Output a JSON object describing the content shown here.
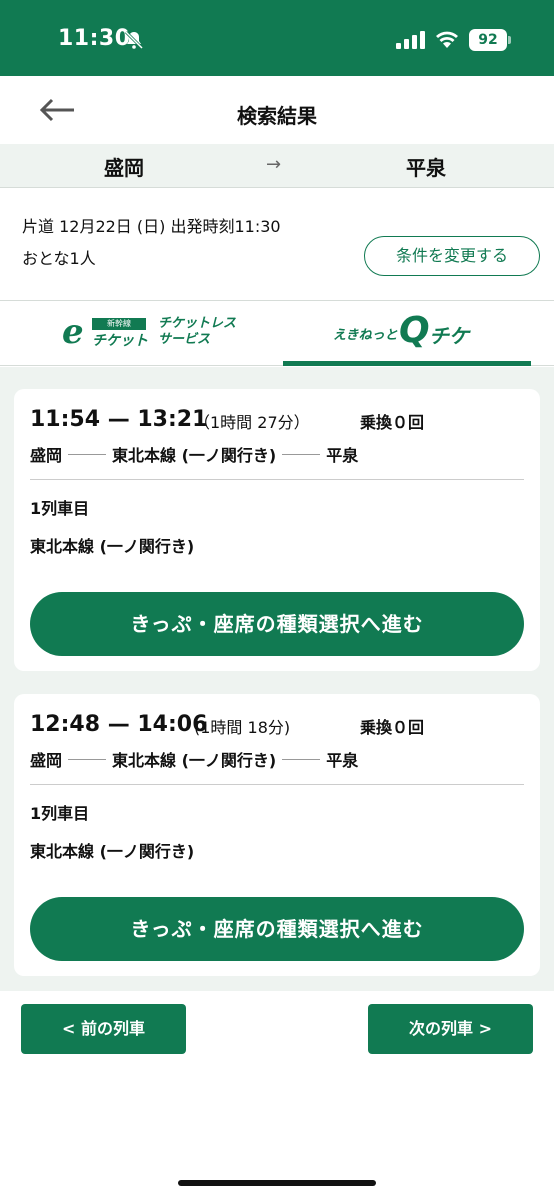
{
  "status": {
    "time": "11:30",
    "battery": "92"
  },
  "header": {
    "title": "検索結果",
    "back_icon": "arrow-left-icon"
  },
  "route": {
    "from": "盛岡",
    "arrow": "→",
    "to": "平泉"
  },
  "conditions": {
    "line1": "片道 12月22日 (日) 出発時刻11:30",
    "line2": "おとな1人",
    "change_label": "条件を変更する"
  },
  "tabs": {
    "left": {
      "tag": "新幹線",
      "e": "e",
      "ticket": "チケット",
      "service_line1": "チケットレス",
      "service_line2": "サービス"
    },
    "right": {
      "ekinet": "えきねっと",
      "q": "Q",
      "chike": "チケ"
    }
  },
  "results": [
    {
      "times": "11:54 — 13:21",
      "duration": "（1時間 27分）",
      "transfer": "乗換０回",
      "from": "盛岡",
      "line": "東北本線 (一ノ関行き)",
      "to": "平泉",
      "train_no": "1列車目",
      "train_name": "東北本線 (一ノ関行き)",
      "select_label": "きっぷ・座席の種類選択へ進む"
    },
    {
      "times": "12:48 — 14:06",
      "duration": "(1時間 18分)",
      "transfer": "乗換０回",
      "from": "盛岡",
      "line": "東北本線 (一ノ関行き)",
      "to": "平泉",
      "train_no": "1列車目",
      "train_name": "東北本線 (一ノ関行き)",
      "select_label": "きっぷ・座席の種類選択へ進む"
    }
  ],
  "pager": {
    "prev_label": "< 前の列車",
    "next_label": "次の列車 >"
  },
  "colors": {
    "brand": "#117a52",
    "panel": "#eef3f0"
  }
}
